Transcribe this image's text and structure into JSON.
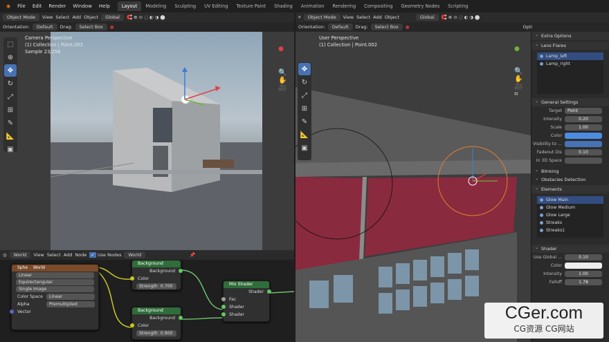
{
  "topbar": {
    "menus": [
      "File",
      "Edit",
      "Render",
      "Window",
      "Help"
    ],
    "workspaces": [
      "Layout",
      "Modeling",
      "Sculpting",
      "UV Editing",
      "Texture Paint",
      "Shading",
      "Animation",
      "Rendering",
      "Compositing",
      "Geometry Nodes",
      "Scripting"
    ],
    "active": "Layout"
  },
  "left_view": {
    "mode": "Object Mode",
    "menus": [
      "View",
      "Select",
      "Add",
      "Object"
    ],
    "transform": "Global",
    "orientation_label": "Orientation:",
    "orientation": "Default",
    "drag_label": "Drag:",
    "drag": "Select Box",
    "info": [
      "Camera Perspective",
      "(1) Collection | Point.002",
      "Sample 23/256"
    ]
  },
  "right_view": {
    "mode": "Object Mode",
    "menus": [
      "View",
      "Select",
      "Add",
      "Object"
    ],
    "transform": "Global",
    "orientation_label": "Orientation:",
    "orientation": "Default",
    "drag_label": "Drag:",
    "drag": "Select Box",
    "overflow": "Opti",
    "info": [
      "User Perspective",
      "(1) Collection | Point.002"
    ]
  },
  "node_editor": {
    "world_label": "World",
    "menus": [
      "View",
      "Select",
      "Add",
      "Node"
    ],
    "use_nodes": "Use Nodes",
    "world2": "World",
    "texture_node": {
      "fields": [
        "Linear",
        "Equirectangular",
        "Single Image"
      ],
      "color_space_label": "Color Space",
      "color_space": "Linear",
      "alpha_label": "Alpha",
      "alpha": "Premultiplied",
      "vector": "Vector",
      "header_a": "Sphe",
      "header_b": "World"
    },
    "background1": {
      "title": "Background",
      "out": "Background",
      "color": "Color",
      "strength": "Strength",
      "strength_val": "0.700"
    },
    "background2": {
      "title": "Background",
      "out": "Background",
      "color": "Color",
      "strength": "Strength",
      "strength_val": "0.900"
    },
    "mix": {
      "title": "Mix Shader",
      "out": "Shader",
      "fac": "Fac",
      "in1": "Shader",
      "in2": "Shader"
    }
  },
  "props": {
    "extra": "Extra Options",
    "lens": "Lens Flares",
    "lamps": [
      "Lamp_left",
      "Lamp_right"
    ],
    "general": "General Settings",
    "rows": [
      {
        "l": "Target",
        "v": "Point"
      },
      {
        "l": "Intensity",
        "v": "0.20"
      },
      {
        "l": "Scale",
        "v": "1.00"
      },
      {
        "l": "Color",
        "v": ""
      },
      {
        "l": "Visibility to ...",
        "v": ""
      },
      {
        "l": "Fadeout Dis",
        "v": "0.10"
      },
      {
        "l": "In 3D Space",
        "v": ""
      }
    ],
    "blinking": "Blinking",
    "obstacles": "Obstacles Detection",
    "elements": "Elements",
    "elements_list": [
      "Glow Main",
      "Glow Medium",
      "Glow Large",
      "Streaks",
      "Streaks1"
    ],
    "shader": "Shader",
    "shader_rows": [
      {
        "l": "Use Global ...",
        "v": "0.10"
      },
      {
        "l": "Color",
        "v": ""
      },
      {
        "l": "Intensity",
        "v": "1.00"
      },
      {
        "l": "Falloff",
        "v": "1.78"
      }
    ]
  },
  "watermark": {
    "main": "CGer.com",
    "sub": "CG资源 CG网站"
  }
}
